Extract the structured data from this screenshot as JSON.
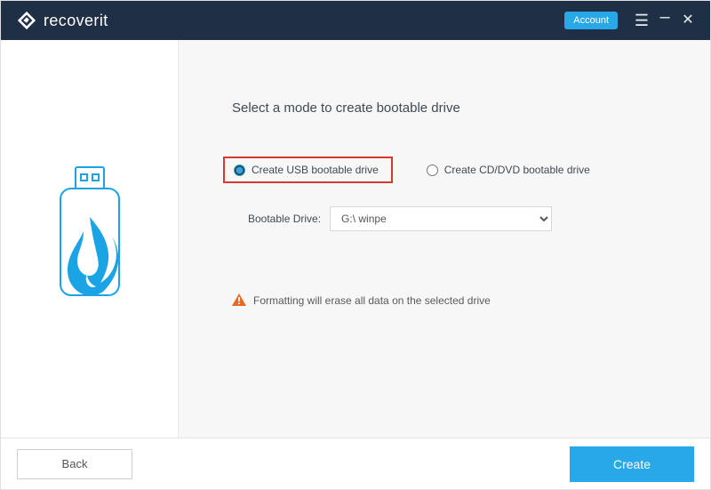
{
  "titlebar": {
    "app_name": "recoverit",
    "account_label": "Account"
  },
  "main": {
    "heading": "Select a mode to create bootable drive",
    "options": {
      "usb": {
        "label": "Create USB bootable drive",
        "checked": true
      },
      "cd": {
        "label": "Create CD/DVD bootable drive",
        "checked": false
      }
    },
    "drive_label": "Bootable Drive:",
    "drive_selected": "G:\\ winpe",
    "warning_text": "Formatting will erase all data on the selected drive"
  },
  "footer": {
    "back_label": "Back",
    "create_label": "Create"
  },
  "colors": {
    "accent": "#28a8e9",
    "titlebar": "#1f2f46",
    "highlight": "#d63a2e",
    "warning": "#e46a26"
  }
}
